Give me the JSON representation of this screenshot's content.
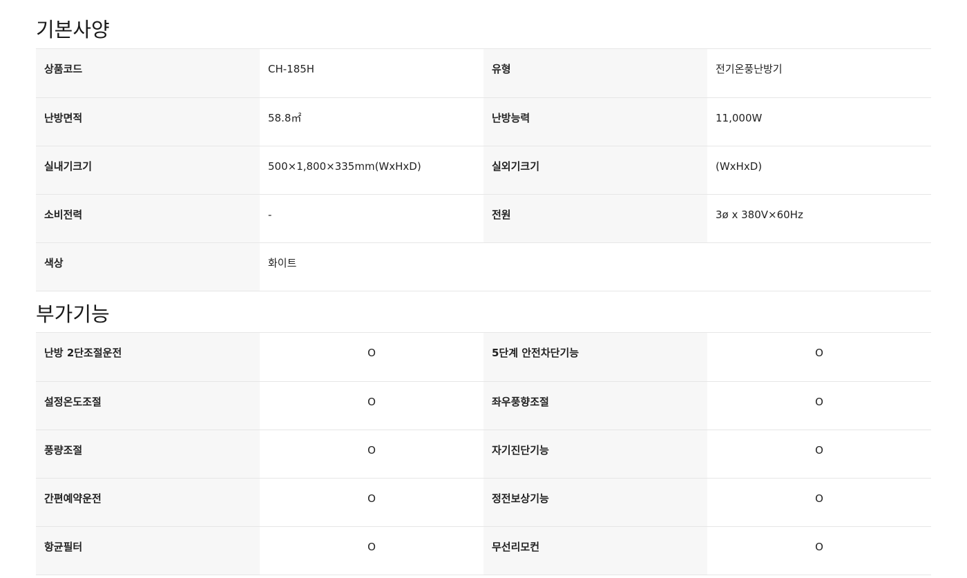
{
  "basic": {
    "title": "기본사양",
    "rows": [
      [
        {
          "label": "상품코드",
          "value": "CH-185H"
        },
        {
          "label": "유형",
          "value": "전기온풍난방기"
        }
      ],
      [
        {
          "label": "난방면적",
          "value": "58.8㎡"
        },
        {
          "label": "난방능력",
          "value": "11,000W"
        }
      ],
      [
        {
          "label": "실내기크기",
          "value": "500×1,800×335mm(WxHxD)"
        },
        {
          "label": "실외기크기",
          "value": "(WxHxD)"
        }
      ],
      [
        {
          "label": "소비전력",
          "value": "-"
        },
        {
          "label": "전원",
          "value": "3ø x 380V×60Hz"
        }
      ],
      [
        {
          "label": "색상",
          "value": "화이트"
        },
        {
          "label": "",
          "value": ""
        }
      ]
    ]
  },
  "extra": {
    "title": "부가기능",
    "rows": [
      [
        {
          "label": "난방 2단조절운전",
          "value": "O"
        },
        {
          "label": "5단계 안전차단기능",
          "value": "O"
        }
      ],
      [
        {
          "label": "설정온도조절",
          "value": "O"
        },
        {
          "label": "좌우풍향조절",
          "value": "O"
        }
      ],
      [
        {
          "label": "풍량조절",
          "value": "O"
        },
        {
          "label": "자기진단기능",
          "value": "O"
        }
      ],
      [
        {
          "label": "간편예약운전",
          "value": "O"
        },
        {
          "label": "정전보상기능",
          "value": "O"
        }
      ],
      [
        {
          "label": "항균필터",
          "value": "O"
        },
        {
          "label": "무선리모컨",
          "value": "O"
        }
      ]
    ]
  }
}
